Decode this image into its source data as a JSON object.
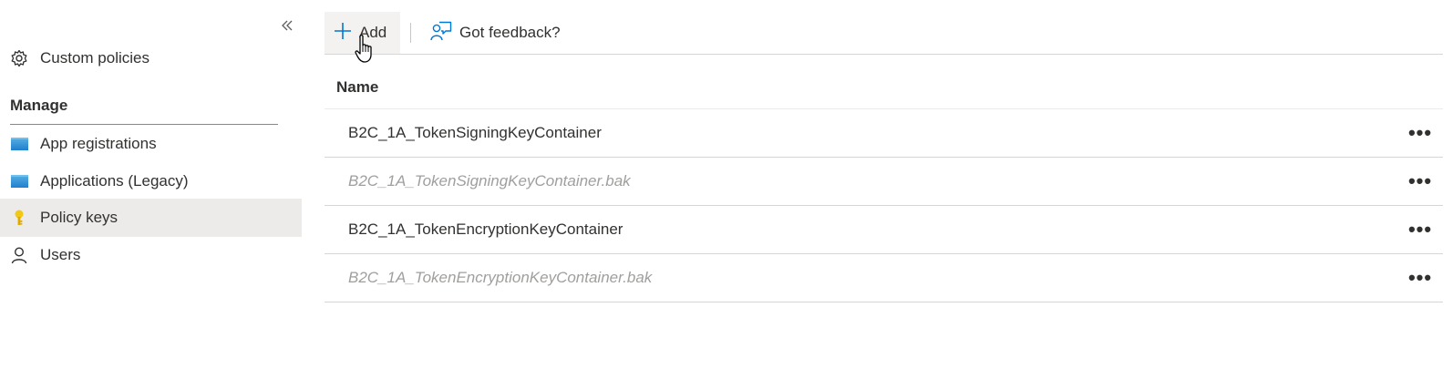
{
  "sidebar": {
    "custom_policies": "Custom policies",
    "manage_heading": "Manage",
    "items": [
      {
        "label": "App registrations",
        "icon": "app-registrations-icon"
      },
      {
        "label": "Applications (Legacy)",
        "icon": "applications-icon"
      },
      {
        "label": "Policy keys",
        "icon": "key-icon",
        "selected": true
      },
      {
        "label": "Users",
        "icon": "user-icon"
      }
    ]
  },
  "toolbar": {
    "add_label": "Add",
    "feedback_label": "Got feedback?"
  },
  "grid": {
    "column_name": "Name",
    "rows": [
      {
        "name": "B2C_1A_TokenSigningKeyContainer",
        "backup": false
      },
      {
        "name": "B2C_1A_TokenSigningKeyContainer.bak",
        "backup": true
      },
      {
        "name": "B2C_1A_TokenEncryptionKeyContainer",
        "backup": false
      },
      {
        "name": "B2C_1A_TokenEncryptionKeyContainer.bak",
        "backup": true
      }
    ],
    "more_label": "•••"
  },
  "colors": {
    "accent": "#0078d4",
    "selected_bg": "#edebe9",
    "key_yellow": "#f2c811"
  }
}
